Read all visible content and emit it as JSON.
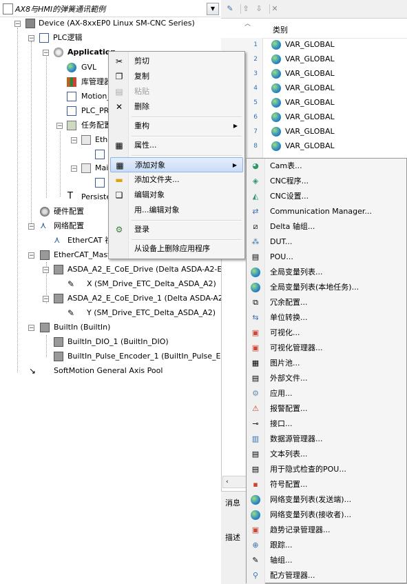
{
  "tree": {
    "root": "AX8与HMI的弹簧通讯範例",
    "rows": [
      "Device (AX-8xxEP0 Linux SM-CNC Series)",
      "PLC逻辑",
      "Application",
      "GVL",
      "库管理器",
      "Motion_",
      "PLC_PRC",
      "任务配置",
      "Ethe",
      "Main",
      "Persiste",
      "硬件配置",
      "网络配置",
      "EtherCAT 视",
      "EtherCAT_Maste",
      "ASDA_A2_E_CoE_Drive (Delta ASDA-A2-E Eth",
      "X (SM_Drive_ETC_Delta_ASDA_A2)",
      "ASDA_A2_E_CoE_Drive_1 (Delta ASDA-A2-E",
      "Y (SM_Drive_ETC_Delta_ASDA_A2)",
      "BuiltIn (BuiltIn)",
      "BuiltIn_DIO_1 (BuiltIn_DIO)",
      "BuiltIn_Pulse_Encoder_1 (BuiltIn_Pulse_Enco",
      "SoftMotion General Axis Pool"
    ]
  },
  "grid": {
    "column_header": "类别",
    "row_numbers": [
      "1",
      "2",
      "3",
      "4",
      "5",
      "6",
      "7",
      "8"
    ],
    "rows": [
      "VAR_GLOBAL",
      "VAR_GLOBAL",
      "VAR_GLOBAL",
      "VAR_GLOBAL",
      "VAR_GLOBAL",
      "VAR_GLOBAL",
      "VAR_GLOBAL",
      "VAR_GLOBAL"
    ]
  },
  "bottom_tabs": {
    "messages": "消息",
    "description": "描述"
  },
  "context_menu": {
    "items": [
      "剪切",
      "复制",
      "粘贴",
      "删除",
      "重构",
      "属性...",
      "添加对象",
      "添加文件夹...",
      "编辑对象",
      "用...编辑对象",
      "登录",
      "从设备上删除应用程序"
    ]
  },
  "submenu": {
    "items": [
      "Cam表...",
      "CNC程序...",
      "CNC设置...",
      "Communication Manager...",
      "Delta 轴组...",
      "DUT...",
      "POU...",
      "全局变量列表...",
      "全局变量列表(本地任务)...",
      "冗余配置...",
      "单位转换...",
      "可视化...",
      "可视化管理器...",
      "图片池...",
      "外部文件...",
      "应用...",
      "报警配置...",
      "接口...",
      "数据源管理器...",
      "文本列表...",
      "用于隐式检查的POU...",
      "符号配置...",
      "网络变量列表(发送端)...",
      "网络变量列表(接收者)...",
      "趋势记录管理器...",
      "跟踪...",
      "轴组...",
      "配方管理器..."
    ]
  },
  "colors": {
    "highlight": "#c9dcf7",
    "highlight_border": "#8eb3e6",
    "row_number": "#2e6fb5"
  }
}
